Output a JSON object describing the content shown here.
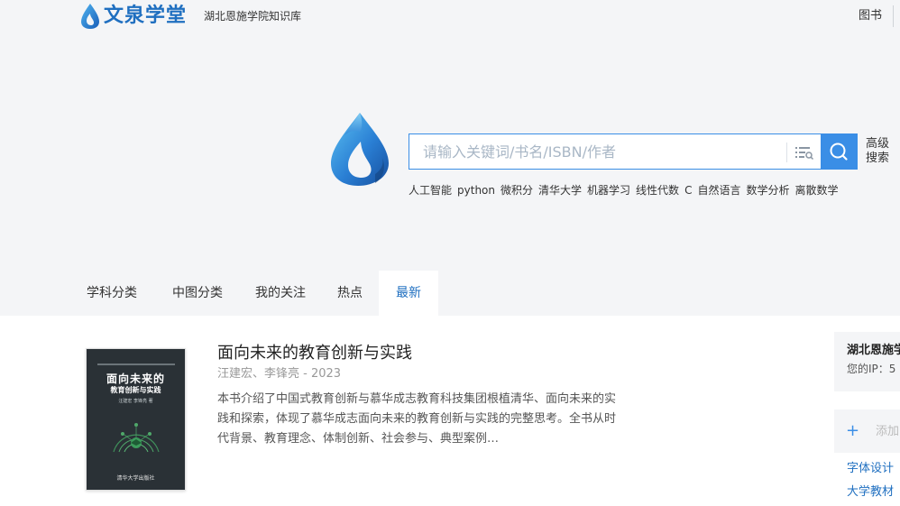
{
  "header": {
    "logo_text": "文泉学堂",
    "logo_subtitle": "湖北恩施学院知识库",
    "nav_books": "图书"
  },
  "search": {
    "placeholder": "请输入关键词/书名/ISBN/作者",
    "value": "",
    "advanced_label": "高级搜索",
    "hot_words": [
      "人工智能",
      "python",
      "微积分",
      "清华大学",
      "机器学习",
      "线性代数",
      "C",
      "自然语言",
      "数学分析",
      "离散数学"
    ]
  },
  "tabs": [
    {
      "label": "学科分类",
      "active": false
    },
    {
      "label": "中图分类",
      "active": false
    },
    {
      "label": "我的关注",
      "active": false
    },
    {
      "label": "热点",
      "active": false
    },
    {
      "label": "最新",
      "active": true
    }
  ],
  "book": {
    "title": "面向未来的教育创新与实践",
    "meta": "汪建宏、李锋亮 - 2023",
    "description": "本书介绍了中国式教育创新与慕华成志教育科技集团根植清华、面向未来的实践和探索，体现了慕华成志面向未来的教育创新与实践的完整思考。全书从时代背景、教育理念、体制创新、社会参与、典型案例…",
    "cover": {
      "title_line1": "面向未来的",
      "title_line2": "教育创新与实践",
      "authors": "汪建宏 李锋亮 著",
      "publisher": "清华大学出版社"
    }
  },
  "sidebar": {
    "org_name": "湖北恩施学",
    "ip_label": "您的IP：5",
    "add_label": "添加",
    "links": [
      "字体设计",
      "大学教材"
    ]
  },
  "colors": {
    "brand": "#1f6fc0",
    "accent": "#3a8ee6",
    "hero_bg": "#f4f5f7"
  },
  "icons": [
    "logo-icon",
    "filter-list-icon",
    "search-icon",
    "plus-icon"
  ]
}
